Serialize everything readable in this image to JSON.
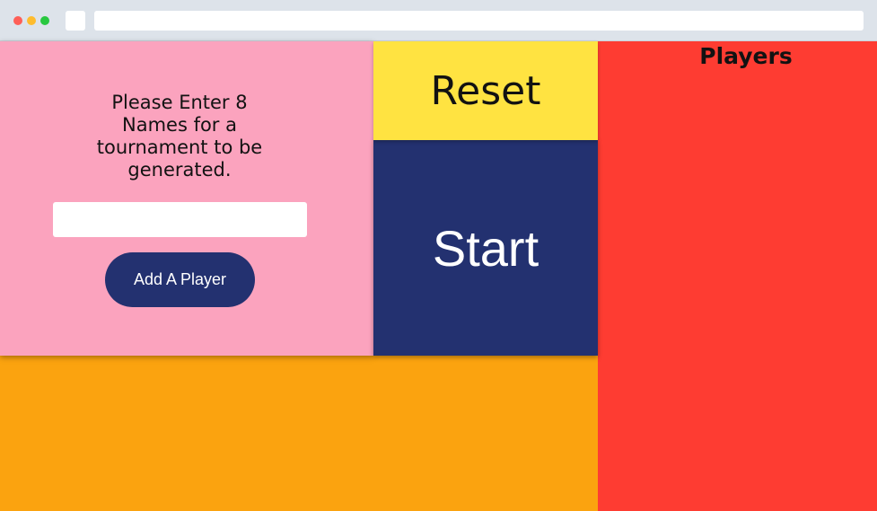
{
  "colors": {
    "chrome_dot_red": "#fe5f57",
    "chrome_dot_yellow": "#febc2e",
    "chrome_dot_green": "#28c840",
    "entry_panel_bg": "#fba3be",
    "reset_bg": "#ffe341",
    "start_bg": "#233170",
    "add_button_bg": "#233170",
    "bracket_bg": "#fba30f",
    "players_bg": "#fe3c32"
  },
  "entry": {
    "prompt": "Please Enter 8 Names for a tournament to be generated.",
    "input_value": "",
    "input_placeholder": "",
    "add_button_label": "Add A Player"
  },
  "controls": {
    "reset_label": "Reset",
    "start_label": "Start"
  },
  "players": {
    "title": "Players",
    "items": []
  }
}
